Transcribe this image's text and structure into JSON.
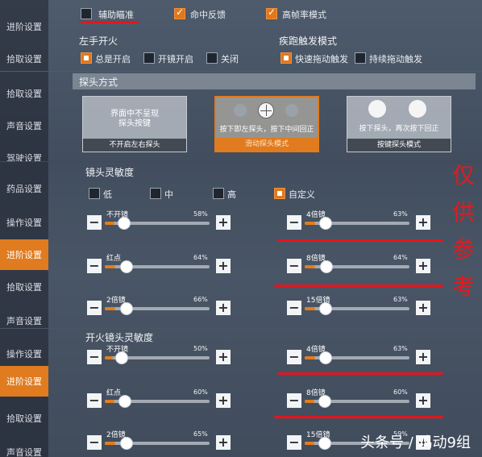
{
  "panel1": {
    "sidebar": [
      "进阶设置",
      "拾取设置"
    ],
    "checks": [
      {
        "label": "辅助瞄准",
        "checked": false
      },
      {
        "label": "命中反馈",
        "checked": true
      },
      {
        "label": "高帧率模式",
        "checked": true
      }
    ],
    "left_fire_title": "左手开火",
    "left_fire_options": [
      {
        "label": "总是开启",
        "checked": true
      },
      {
        "label": "开镜开启",
        "checked": false
      },
      {
        "label": "关闭",
        "checked": false
      }
    ],
    "sprint_title": "疾跑触发模式",
    "sprint_options": [
      {
        "label": "快速拖动触发",
        "checked": true
      },
      {
        "label": "持续拖动触发",
        "checked": false
      }
    ]
  },
  "panel2": {
    "sidebar": [
      "拾取设置",
      "声音设置",
      "驾驶设置"
    ],
    "title": "探头方式",
    "cards": [
      {
        "text": "界面中不呈现\n探头按键",
        "footer": "不开启左右探头"
      },
      {
        "text": "按下即左探头，按下中间回正",
        "footer": "滑动探头模式"
      },
      {
        "text": "按下探头，再次按下回正",
        "footer": "按键探头模式"
      }
    ]
  },
  "panel3": {
    "sidebar": [
      "药品设置",
      "操作设置",
      "进阶设置",
      "拾取设置",
      "声音设置"
    ],
    "title": "镜头灵敏度",
    "modes": [
      {
        "label": "低",
        "checked": false
      },
      {
        "label": "中",
        "checked": false
      },
      {
        "label": "高",
        "checked": false
      },
      {
        "label": "自定义",
        "checked": true
      }
    ],
    "sliders": [
      {
        "label": "不开镜",
        "percent": "58%",
        "value": 0.58
      },
      {
        "label": "4倍镜",
        "percent": "63%",
        "value": 0.63
      },
      {
        "label": "红点",
        "percent": "64%",
        "value": 0.64
      },
      {
        "label": "8倍镜",
        "percent": "64%",
        "value": 0.64
      },
      {
        "label": "2倍镜",
        "percent": "66%",
        "value": 0.66
      },
      {
        "label": "15倍镜",
        "percent": "63%",
        "value": 0.63
      }
    ]
  },
  "panel4": {
    "sidebar": [
      "操作设置",
      "进阶设置",
      "拾取设置",
      "声音设置"
    ],
    "title": "开火镜头灵敏度",
    "sliders": [
      {
        "label": "不开镜",
        "percent": "50%",
        "value": 0.5
      },
      {
        "label": "4倍镜",
        "percent": "63%",
        "value": 0.63
      },
      {
        "label": "红点",
        "percent": "60%",
        "value": 0.6
      },
      {
        "label": "8倍镜",
        "percent": "60%",
        "value": 0.6
      },
      {
        "label": "2倍镜",
        "percent": "65%",
        "value": 0.65
      },
      {
        "label": "15倍镜",
        "percent": "59%",
        "value": 0.59
      }
    ]
  },
  "overlay": {
    "vertical_text": "仅供参考",
    "watermark": "头条号 / 鸡动9组"
  }
}
